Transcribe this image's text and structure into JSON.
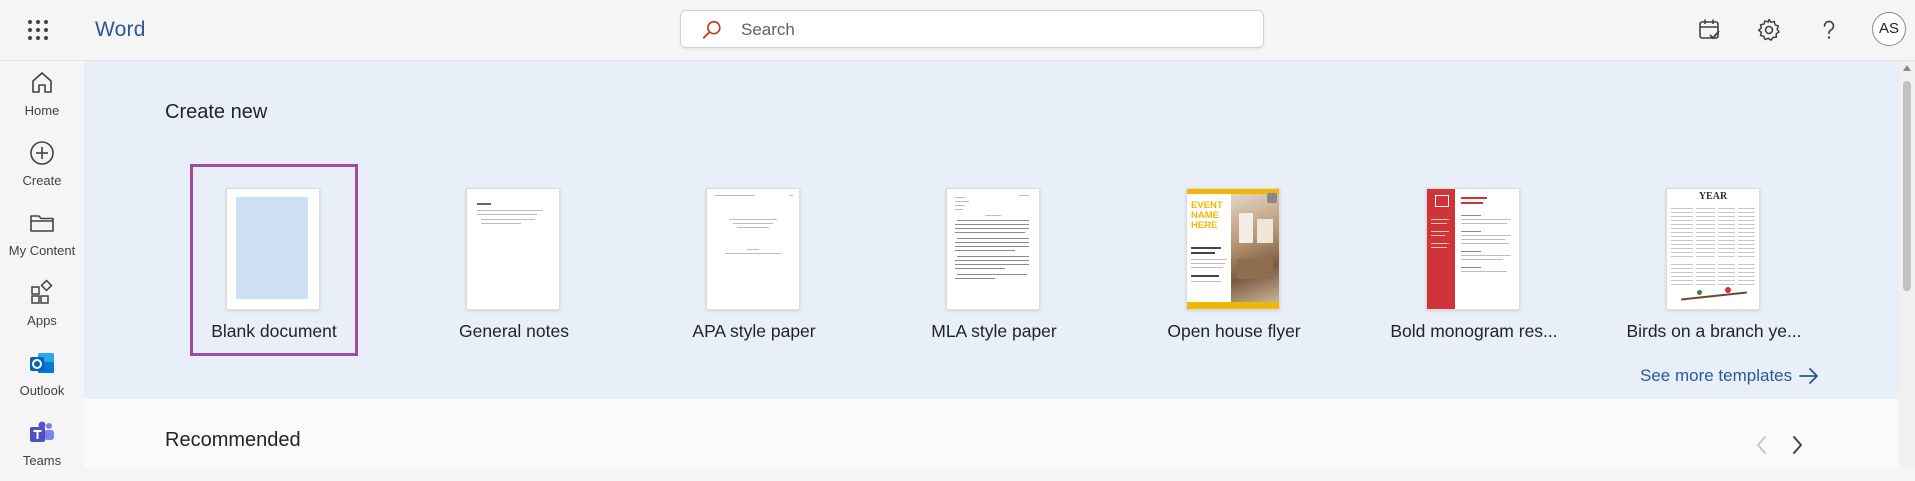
{
  "app": {
    "name": "Word",
    "brand_color": "#2b579a"
  },
  "search": {
    "placeholder": "Search",
    "icon": "search-icon",
    "accent_color": "#c43e1c"
  },
  "header_actions": [
    {
      "name": "calendar-check-icon"
    },
    {
      "name": "gear-icon"
    },
    {
      "name": "help-icon"
    }
  ],
  "user": {
    "initials": "AS"
  },
  "rail": {
    "items": [
      {
        "label": "Home",
        "icon": "home-icon"
      },
      {
        "label": "Create",
        "icon": "plus-circle-icon"
      },
      {
        "label": "My Content",
        "icon": "folder-icon"
      },
      {
        "label": "Apps",
        "icon": "apps-icon"
      },
      {
        "label": "Outlook",
        "icon": "outlook-icon"
      },
      {
        "label": "Teams",
        "icon": "teams-icon"
      }
    ]
  },
  "create_new": {
    "title": "Create new",
    "templates": [
      {
        "label": "Blank document",
        "selected": true
      },
      {
        "label": "General notes"
      },
      {
        "label": "APA style paper"
      },
      {
        "label": "MLA style paper"
      },
      {
        "label": "Open house flyer",
        "thumb_text": "EVENT NAME HERE"
      },
      {
        "label": "Bold monogram res..."
      },
      {
        "label": "Birds on a branch ye...",
        "thumb_text": "YEAR"
      }
    ],
    "see_more": "See more templates"
  },
  "recommended": {
    "title": "Recommended"
  }
}
